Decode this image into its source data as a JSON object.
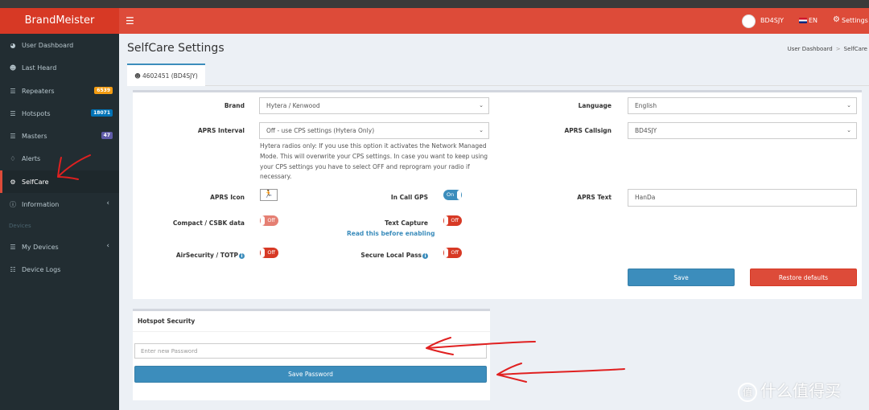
{
  "header": {
    "logo": "BrandMeister",
    "menu_icon": "hamburger-icon",
    "user": "BD4SJY",
    "language": "EN",
    "settings": "Settings"
  },
  "sidebar": {
    "items": [
      {
        "label": "User Dashboard",
        "icon": "dashboard-icon"
      },
      {
        "label": "Last Heard",
        "icon": "user-icon"
      },
      {
        "label": "Repeaters",
        "icon": "list-icon",
        "badge": "6539",
        "badge_color": "#f39c12"
      },
      {
        "label": "Hotspots",
        "icon": "list-icon",
        "badge": "18071",
        "badge_color": "#0073b7"
      },
      {
        "label": "Masters",
        "icon": "list-icon",
        "badge": "47",
        "badge_color": "#605ca8"
      },
      {
        "label": "Alerts",
        "icon": "bell-icon"
      },
      {
        "label": "SelfCare",
        "icon": "gear-icon"
      },
      {
        "label": "Information",
        "icon": "info-icon"
      }
    ],
    "section_header": "Devices",
    "devices": [
      {
        "label": "My Devices",
        "icon": "list-icon"
      },
      {
        "label": "Device Logs",
        "icon": "book-icon"
      }
    ]
  },
  "page": {
    "title": "SelfCare Settings",
    "breadcrumb": [
      "User Dashboard",
      "SelfCare"
    ],
    "tab": "4602451 (BD4SJY)"
  },
  "form": {
    "brand_label": "Brand",
    "brand_value": "Hytera / Kenwood",
    "language_label": "Language",
    "language_value": "English",
    "aprs_interval_label": "APRS Interval",
    "aprs_interval_value": "Off - use CPS settings (Hytera Only)",
    "aprs_callsign_label": "APRS Callsign",
    "aprs_callsign_value": "BD4SJY",
    "help_text": "Hytera radios only: If you use this option it activates the Network Managed Mode. This will overwrite your CPS settings. In case you want to keep using your CPS settings you have to select OFF and reprogram your radio if necessary.",
    "aprs_icon_label": "APRS Icon",
    "aprs_icon_glyph": "🏃",
    "in_call_gps_label": "In Call GPS",
    "in_call_gps_state": "On",
    "aprs_text_label": "APRS Text",
    "aprs_text_value": "HanDa",
    "compact_label": "Compact / CSBK data",
    "compact_state": "Off",
    "text_capture_label": "Text Capture",
    "text_capture_state": "Off",
    "read_before_link": "Read this before enabling",
    "airsecurity_label": "AirSecurity / TOTP",
    "airsecurity_state": "Off",
    "secure_local_label": "Secure Local Pass",
    "secure_local_state": "Off",
    "save_button": "Save",
    "restore_button": "Restore defaults"
  },
  "hotspot": {
    "title": "Hotspot Security",
    "password_placeholder": "Enter new Password",
    "save_password_button": "Save Password"
  },
  "watermark": {
    "badge": "值",
    "text": "什么值得买"
  },
  "colors": {
    "brand_red": "#dd4b39",
    "sidebar": "#222d32",
    "primary_blue": "#3c8dbc",
    "annotation_red": "#e02020"
  }
}
